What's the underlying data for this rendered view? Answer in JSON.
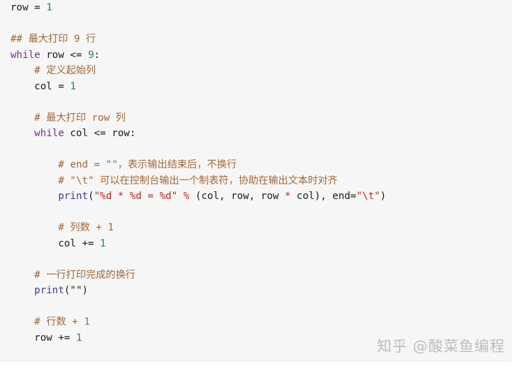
{
  "colors": {
    "background": "#f6f6f6",
    "comment": "#a0683a",
    "keyword": "#7a2f8a",
    "number": "#2e7d5b",
    "string": "#b32a2a",
    "builtin": "#4a3596",
    "text": "#1a1a1a",
    "watermark": "#bdbdbd"
  },
  "code": {
    "lines": [
      [
        {
          "t": "row = ",
          "c": "plain"
        },
        {
          "t": "1",
          "c": "number"
        }
      ],
      [],
      [
        {
          "t": "## 最大打印 9 行",
          "c": "comment"
        }
      ],
      [
        {
          "t": "while",
          "c": "keyword"
        },
        {
          "t": " row <= ",
          "c": "plain"
        },
        {
          "t": "9",
          "c": "number"
        },
        {
          "t": ":",
          "c": "plain"
        }
      ],
      [
        {
          "t": "    ",
          "c": "plain"
        },
        {
          "t": "# 定义起始列",
          "c": "comment"
        }
      ],
      [
        {
          "t": "    col = ",
          "c": "plain"
        },
        {
          "t": "1",
          "c": "number"
        }
      ],
      [],
      [
        {
          "t": "    ",
          "c": "plain"
        },
        {
          "t": "# 最大打印 row 列",
          "c": "comment"
        }
      ],
      [
        {
          "t": "    ",
          "c": "plain"
        },
        {
          "t": "while",
          "c": "keyword"
        },
        {
          "t": " col <= row:",
          "c": "plain"
        }
      ],
      [],
      [
        {
          "t": "        ",
          "c": "plain"
        },
        {
          "t": "# end = \"\"，表示输出结束后，不换行",
          "c": "comment"
        }
      ],
      [
        {
          "t": "        ",
          "c": "plain"
        },
        {
          "t": "# \"\\t\" 可以在控制台输出一个制表符，协助在输出文本时对齐",
          "c": "comment"
        }
      ],
      [
        {
          "t": "        ",
          "c": "plain"
        },
        {
          "t": "print",
          "c": "builtin"
        },
        {
          "t": "(",
          "c": "plain"
        },
        {
          "t": "\"%d * %d = %d\"",
          "c": "string"
        },
        {
          "t": " ",
          "c": "plain"
        },
        {
          "t": "%",
          "c": "op-red"
        },
        {
          "t": " (col, row, row ",
          "c": "plain"
        },
        {
          "t": "*",
          "c": "op-red"
        },
        {
          "t": " col), end=",
          "c": "plain"
        },
        {
          "t": "\"\\t\"",
          "c": "string"
        },
        {
          "t": ")",
          "c": "plain"
        }
      ],
      [],
      [
        {
          "t": "        ",
          "c": "plain"
        },
        {
          "t": "# 列数 + 1",
          "c": "comment"
        }
      ],
      [
        {
          "t": "        col += ",
          "c": "plain"
        },
        {
          "t": "1",
          "c": "number"
        }
      ],
      [],
      [
        {
          "t": "    ",
          "c": "plain"
        },
        {
          "t": "# 一行打印完成的换行",
          "c": "comment"
        }
      ],
      [
        {
          "t": "    ",
          "c": "plain"
        },
        {
          "t": "print",
          "c": "builtin"
        },
        {
          "t": "(\"\")",
          "c": "plain"
        }
      ],
      [],
      [
        {
          "t": "    ",
          "c": "plain"
        },
        {
          "t": "# 行数 + 1",
          "c": "comment"
        }
      ],
      [
        {
          "t": "    row += ",
          "c": "plain"
        },
        {
          "t": "1",
          "c": "number"
        }
      ]
    ]
  },
  "watermark": {
    "text": "知乎 @酸菜鱼编程"
  }
}
